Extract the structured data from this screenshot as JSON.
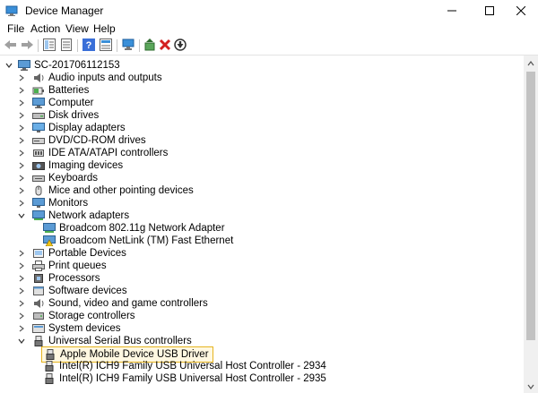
{
  "window": {
    "title": "Device Manager",
    "controls": {
      "minimize": "minimize-icon",
      "maximize": "maximize-icon",
      "close": "close-icon"
    }
  },
  "menu": [
    "File",
    "Action",
    "View",
    "Help"
  ],
  "toolbar": {
    "buttons": [
      "back-arrow-icon",
      "forward-arrow-icon",
      "show-hide-tree-icon",
      "properties-icon",
      "help-icon",
      "view-details-icon",
      "scan-hardware-icon",
      "update-driver-icon",
      "uninstall-icon",
      "disable-device-icon"
    ]
  },
  "tree": {
    "root": "SC-201706112153",
    "categories": [
      "Audio inputs and outputs",
      "Batteries",
      "Computer",
      "Disk drives",
      "Display adapters",
      "DVD/CD-ROM drives",
      "IDE ATA/ATAPI controllers",
      "Imaging devices",
      "Keyboards",
      "Mice and other pointing devices",
      "Monitors",
      "Network adapters",
      "Portable Devices",
      "Print queues",
      "Processors",
      "Software devices",
      "Sound, video and game controllers",
      "Storage controllers",
      "System devices",
      "Universal Serial Bus controllers"
    ],
    "network_children": [
      "Broadcom 802.11g Network Adapter",
      "Broadcom NetLink (TM) Fast Ethernet"
    ],
    "usb_children": [
      "Apple Mobile Device USB Driver",
      "Intel(R) ICH9 Family USB Universal Host Controller - 2934",
      "Intel(R) ICH9 Family USB Universal Host Controller - 2935"
    ],
    "selected": "Apple Mobile Device USB Driver"
  },
  "colors": {
    "selection_border": "#e6b420",
    "warning": "#f0c419",
    "icon_blue": "#2d7dd2"
  }
}
